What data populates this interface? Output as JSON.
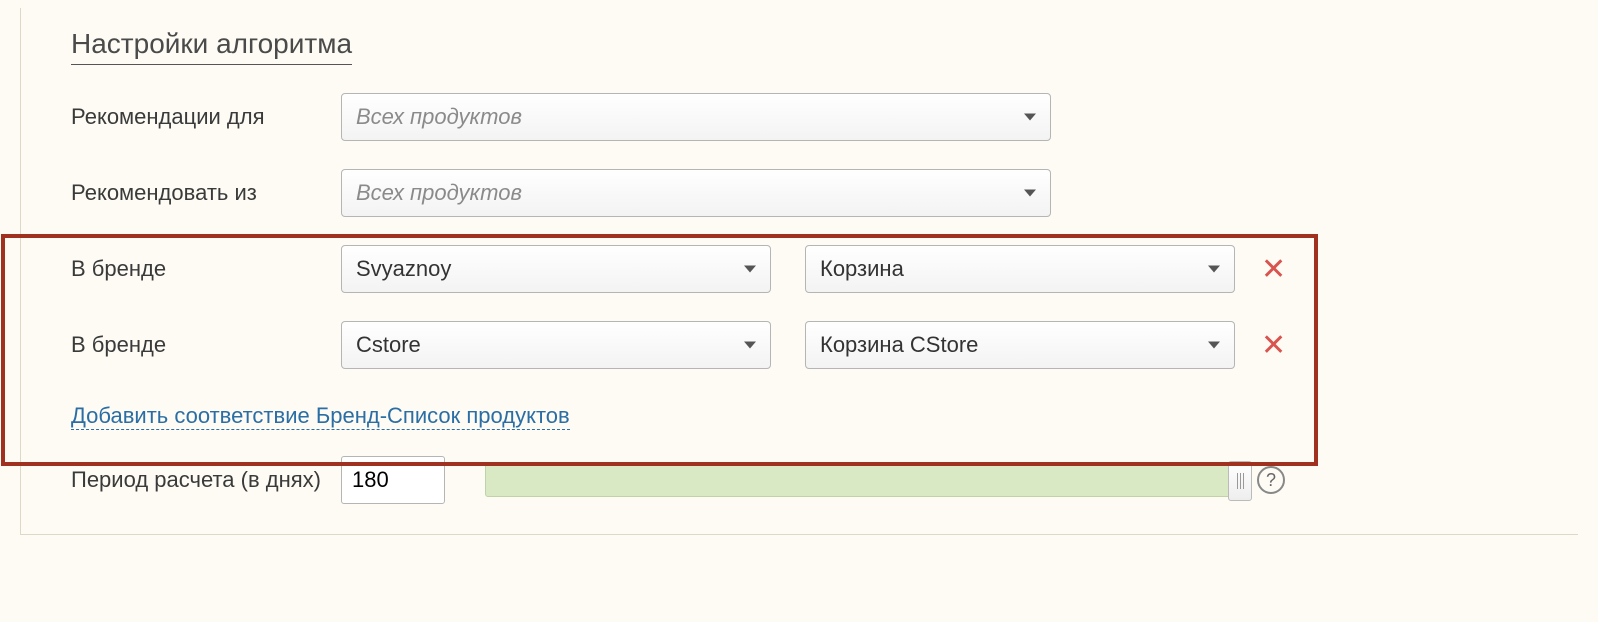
{
  "section_title": "Настройки алгоритма",
  "recommendations_for": {
    "label": "Рекомендации для",
    "value": "Всех продуктов"
  },
  "recommend_from": {
    "label": "Рекомендовать из",
    "value": "Всех продуктов"
  },
  "brand_rows": [
    {
      "label": "В бренде",
      "brand": "Svyaznoy",
      "list": "Корзина"
    },
    {
      "label": "В бренде",
      "brand": "Cstore",
      "list": "Корзина CStore"
    }
  ],
  "add_link_text": "Добавить соответствие Бренд-Список продуктов",
  "period": {
    "label": "Период расчета (в днях)",
    "value": "180"
  },
  "icons": {
    "remove": "✕",
    "help": "?"
  }
}
